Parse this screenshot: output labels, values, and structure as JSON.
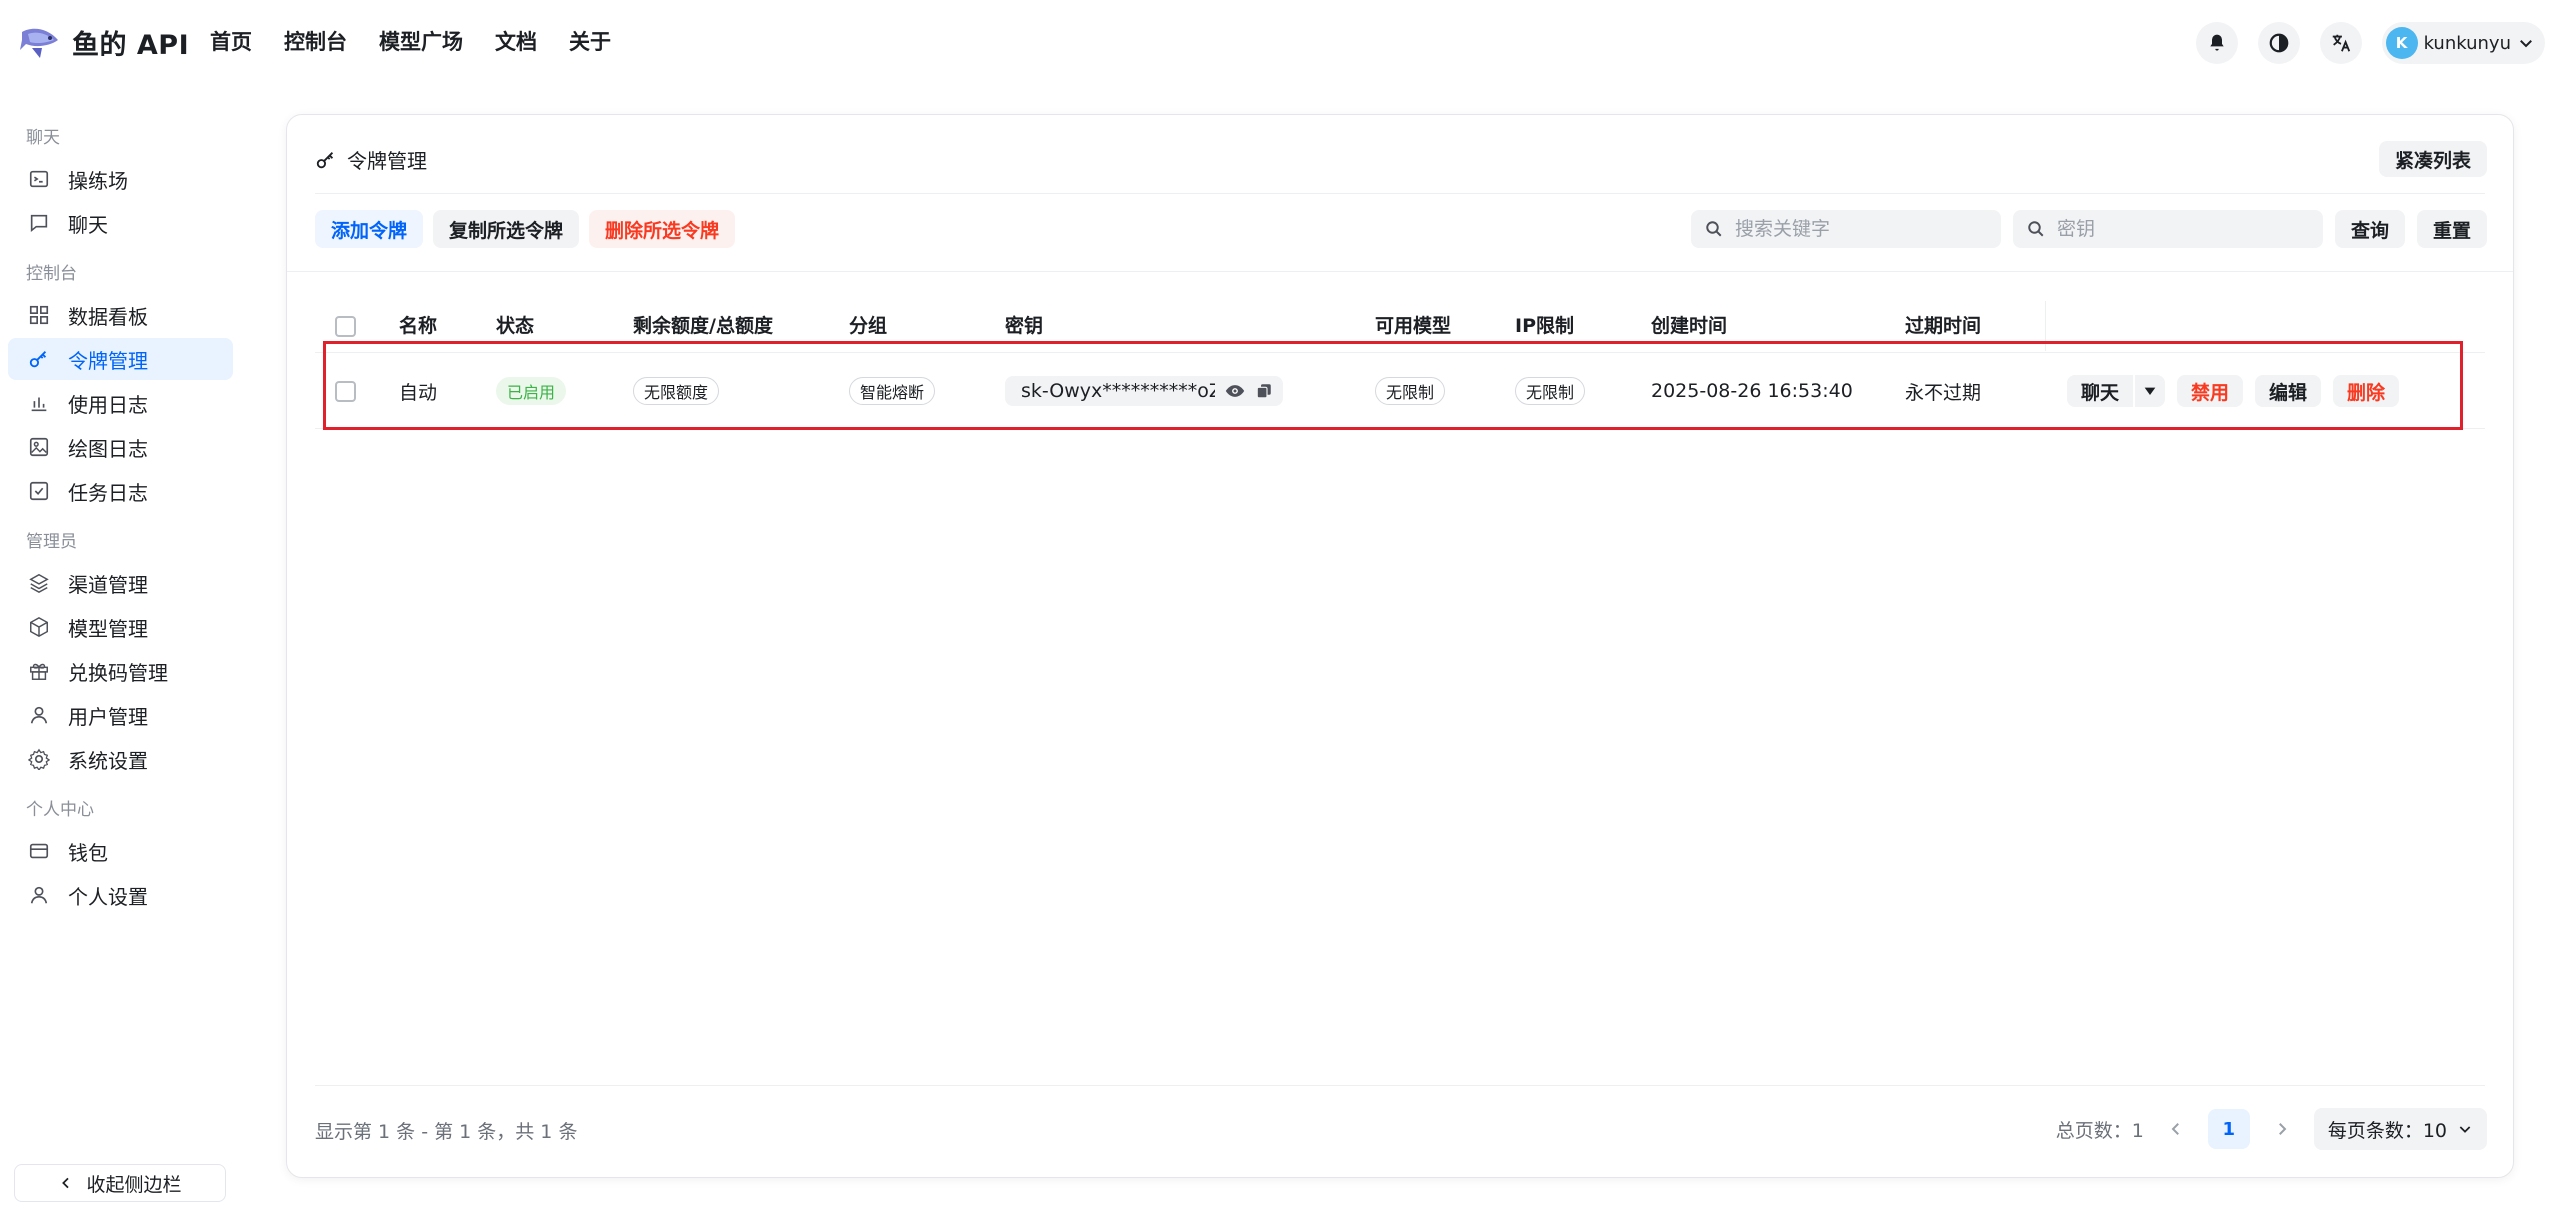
{
  "app": {
    "brand": "鱼的 API",
    "user_initial": "K",
    "user_name": "kunkunyu",
    "accent": "#0064fa",
    "danger": "#f93920",
    "success": "#3bb346"
  },
  "topnav": [
    "首页",
    "控制台",
    "模型广场",
    "文档",
    "关于"
  ],
  "sidebar": {
    "groups": [
      {
        "label": "聊天",
        "items": [
          {
            "label": "操练场",
            "icon": "playground-icon"
          },
          {
            "label": "聊天",
            "icon": "chat-icon"
          }
        ]
      },
      {
        "label": "控制台",
        "items": [
          {
            "label": "数据看板",
            "icon": "dashboard-icon"
          },
          {
            "label": "令牌管理",
            "icon": "key-icon",
            "active": true
          },
          {
            "label": "使用日志",
            "icon": "bar-chart-icon"
          },
          {
            "label": "绘图日志",
            "icon": "image-icon"
          },
          {
            "label": "任务日志",
            "icon": "task-icon"
          }
        ]
      },
      {
        "label": "管理员",
        "items": [
          {
            "label": "渠道管理",
            "icon": "layers-icon"
          },
          {
            "label": "模型管理",
            "icon": "cube-icon"
          },
          {
            "label": "兑换码管理",
            "icon": "gift-icon"
          },
          {
            "label": "用户管理",
            "icon": "user-icon"
          },
          {
            "label": "系统设置",
            "icon": "gear-icon"
          }
        ]
      },
      {
        "label": "个人中心",
        "items": [
          {
            "label": "钱包",
            "icon": "wallet-icon"
          },
          {
            "label": "个人设置",
            "icon": "user-icon"
          }
        ]
      }
    ],
    "collapse_label": "收起侧边栏"
  },
  "card": {
    "title": "令牌管理",
    "compact_label": "紧凑列表",
    "toolbar": {
      "add": "添加令牌",
      "copy": "复制所选令牌",
      "delete": "删除所选令牌"
    },
    "search": {
      "keyword_placeholder": "搜索关键字",
      "key_placeholder": "密钥",
      "query": "查询",
      "reset": "重置"
    }
  },
  "table": {
    "columns": [
      "名称",
      "状态",
      "剩余额度/总额度",
      "分组",
      "密钥",
      "可用模型",
      "IP限制",
      "创建时间",
      "过期时间"
    ],
    "rows": [
      {
        "name": "自动",
        "status": "已启用",
        "quota": "无限额度",
        "group": "智能熔断",
        "key": "sk-Owyx**********oZQ",
        "models": "无限制",
        "ip_limit": "无限制",
        "created": "2025-08-26 16:53:40",
        "expires": "永不过期",
        "actions": {
          "chat": "聊天",
          "disable": "禁用",
          "edit": "编辑",
          "delete": "删除"
        }
      }
    ]
  },
  "footer": {
    "info": "显示第 1 条 - 第 1 条，共 1 条",
    "total_pages": "总页数：1",
    "current_page": "1",
    "per_page": "每页条数：10"
  }
}
